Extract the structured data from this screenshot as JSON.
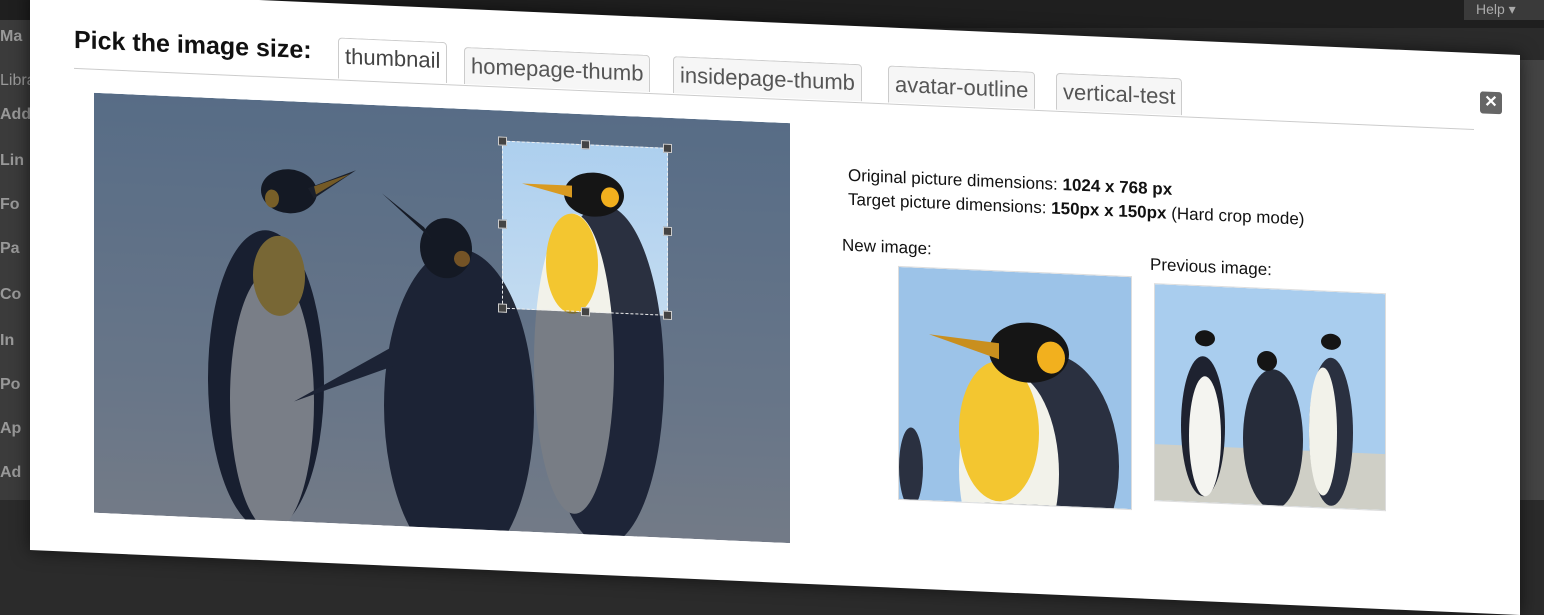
{
  "background": {
    "help_label": "Help ▾",
    "menu_items": [
      "Ma",
      "Libra",
      "Add N",
      "Lin",
      "Fo",
      "Pa",
      "Co",
      "In",
      "Po",
      "Ap",
      "Ad"
    ]
  },
  "modal": {
    "title": "Pick the image size:",
    "close_icon_glyph": "✕",
    "tabs": [
      {
        "label": "thumbnail",
        "active": true
      },
      {
        "label": "homepage-thumb",
        "active": false
      },
      {
        "label": "insidepage-thumb",
        "active": false
      },
      {
        "label": "avatar-outline",
        "active": false
      },
      {
        "label": "vertical-test",
        "active": false
      }
    ],
    "info": {
      "original_label": "Original picture dimensions:",
      "original_value": "1024 x 768 px",
      "target_label": "Target picture dimensions:",
      "target_value": "150px x 150px",
      "target_mode": "(Hard crop mode)"
    },
    "new_image_label": "New image:",
    "previous_image_label": "Previous image:"
  },
  "colors": {
    "accent_yellow": "#f2b01e",
    "sky": "#9cc3e8",
    "dim_overlay": "rgba(20,30,50,0.55)"
  }
}
